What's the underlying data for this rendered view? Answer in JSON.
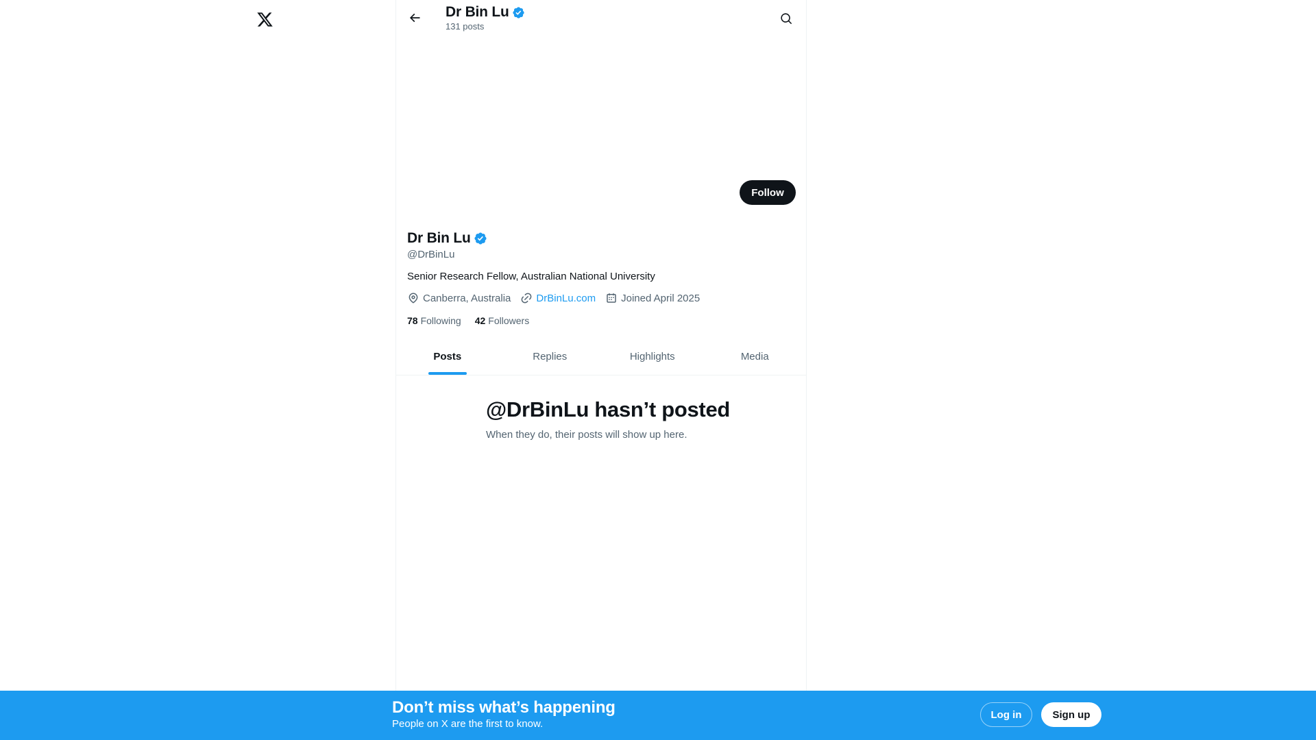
{
  "header": {
    "name": "Dr Bin Lu",
    "post_count": "131 posts"
  },
  "profile": {
    "name": "Dr Bin Lu",
    "handle": "@DrBinLu",
    "bio": "Senior Research Fellow, Australian National University",
    "location": "Canberra, Australia",
    "website": "DrBinLu.com",
    "joined": "Joined April 2025",
    "following_count": "78",
    "following_label": "Following",
    "followers_count": "42",
    "followers_label": "Followers",
    "follow_label": "Follow"
  },
  "tabs": [
    {
      "label": "Posts",
      "active": true
    },
    {
      "label": "Replies",
      "active": false
    },
    {
      "label": "Highlights",
      "active": false
    },
    {
      "label": "Media",
      "active": false
    }
  ],
  "empty_state": {
    "title": "@DrBinLu hasn’t posted",
    "subtitle": "When they do, their posts will show up here."
  },
  "bottom_bar": {
    "title": "Don’t miss what’s happening",
    "subtitle": "People on X are the first to know.",
    "login_label": "Log in",
    "signup_label": "Sign up"
  },
  "icons": {
    "logo": "x-logo-icon",
    "back": "arrow-left-icon",
    "search": "search-icon",
    "verified": "verified-badge-icon",
    "location": "location-pin-icon",
    "link": "link-icon",
    "calendar": "calendar-icon"
  },
  "colors": {
    "accent": "#1d9bf0",
    "text_primary": "#0f1419",
    "text_secondary": "#536471",
    "follow_button_bg": "#0f1419",
    "bottom_bar_bg": "#1d9bf0"
  }
}
